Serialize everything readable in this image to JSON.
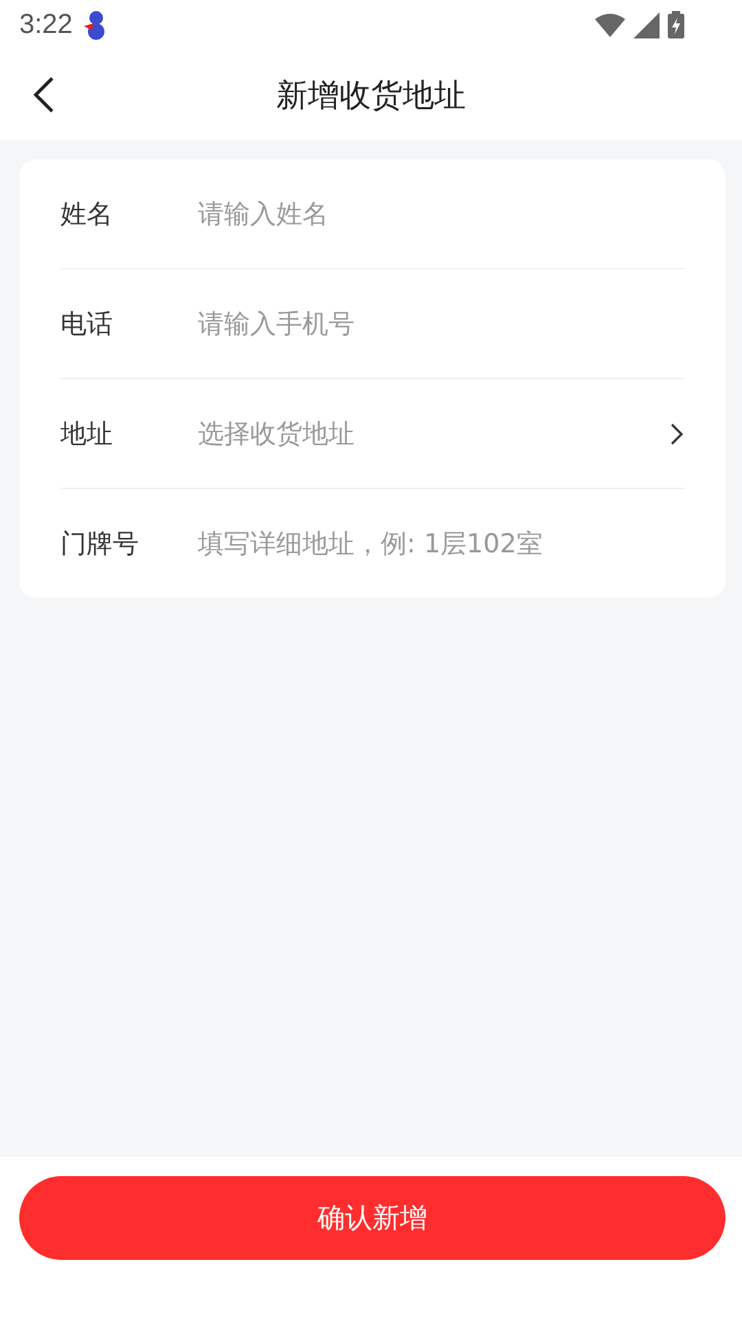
{
  "status_bar": {
    "time": "3:22"
  },
  "header": {
    "title": "新增收货地址"
  },
  "form": {
    "fields": [
      {
        "kind": "input",
        "label": "姓名",
        "placeholder": "请输入姓名"
      },
      {
        "kind": "input",
        "label": "电话",
        "placeholder": "请输入手机号"
      },
      {
        "kind": "select",
        "label": "地址",
        "placeholder": "选择收货地址"
      },
      {
        "kind": "input",
        "label": "门牌号",
        "placeholder": "填写详细地址，例: 1层102室"
      }
    ]
  },
  "submit_button": "确认新增"
}
